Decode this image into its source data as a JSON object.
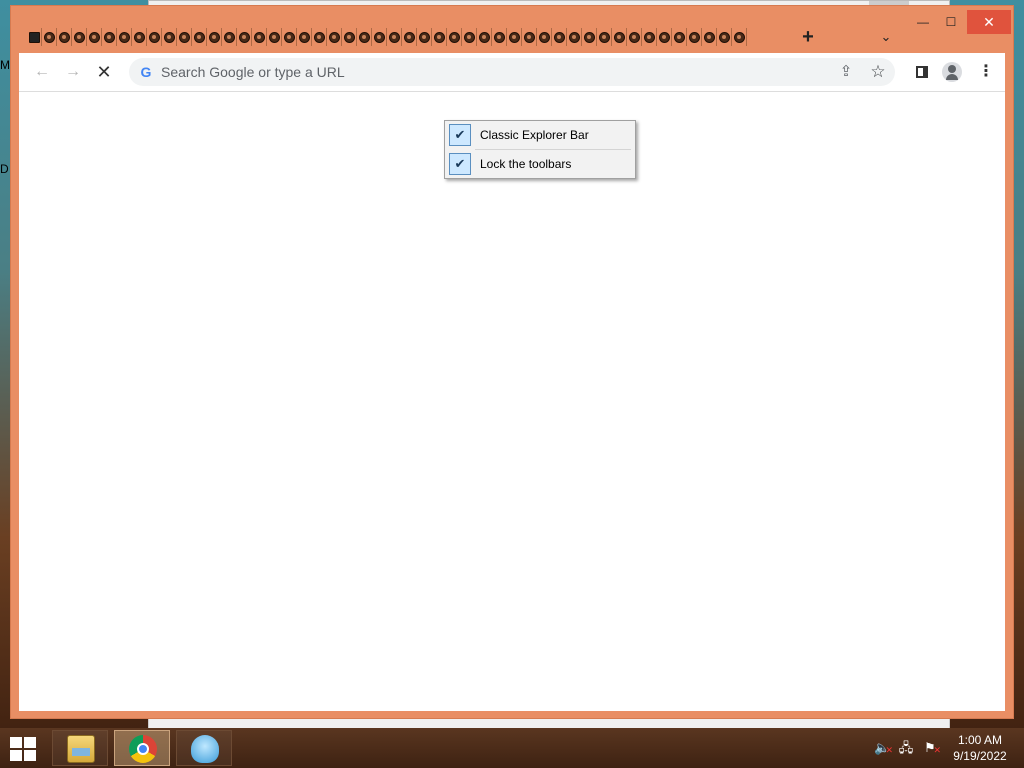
{
  "desktop": {
    "label_top": "M",
    "label_bottom": "D"
  },
  "window": {
    "tab_count": 48,
    "new_tab_glyph": "+",
    "tab_search_glyph": "⌄",
    "min_glyph": "—",
    "max_glyph": "☐",
    "close_glyph": "✕"
  },
  "toolbar": {
    "back_glyph": "←",
    "forward_glyph": "→",
    "stop_glyph": "✕",
    "omnibox_placeholder": "Search Google or type a URL",
    "google_glyph": "G",
    "share_glyph": "⇪",
    "star_glyph": "☆",
    "menu_glyph": "⋮"
  },
  "context_menu": {
    "items": [
      {
        "label": "Classic Explorer Bar",
        "checked": true,
        "check_glyph": "✔"
      },
      {
        "label": "Lock the toolbars",
        "checked": true,
        "check_glyph": "✔"
      }
    ]
  },
  "taskbar": {
    "clock_time": "1:00 AM",
    "clock_date": "9/19/2022",
    "sound_glyph": "🔈",
    "network_glyph": "🖧",
    "flag_glyph": "⚑",
    "error_glyph": "✕"
  },
  "icons": {
    "pinned_tab": "trash-icon",
    "tab": "favicon-icon",
    "explorer": "file-explorer-icon",
    "chrome": "chrome-icon",
    "other": "classic-shell-icon"
  }
}
